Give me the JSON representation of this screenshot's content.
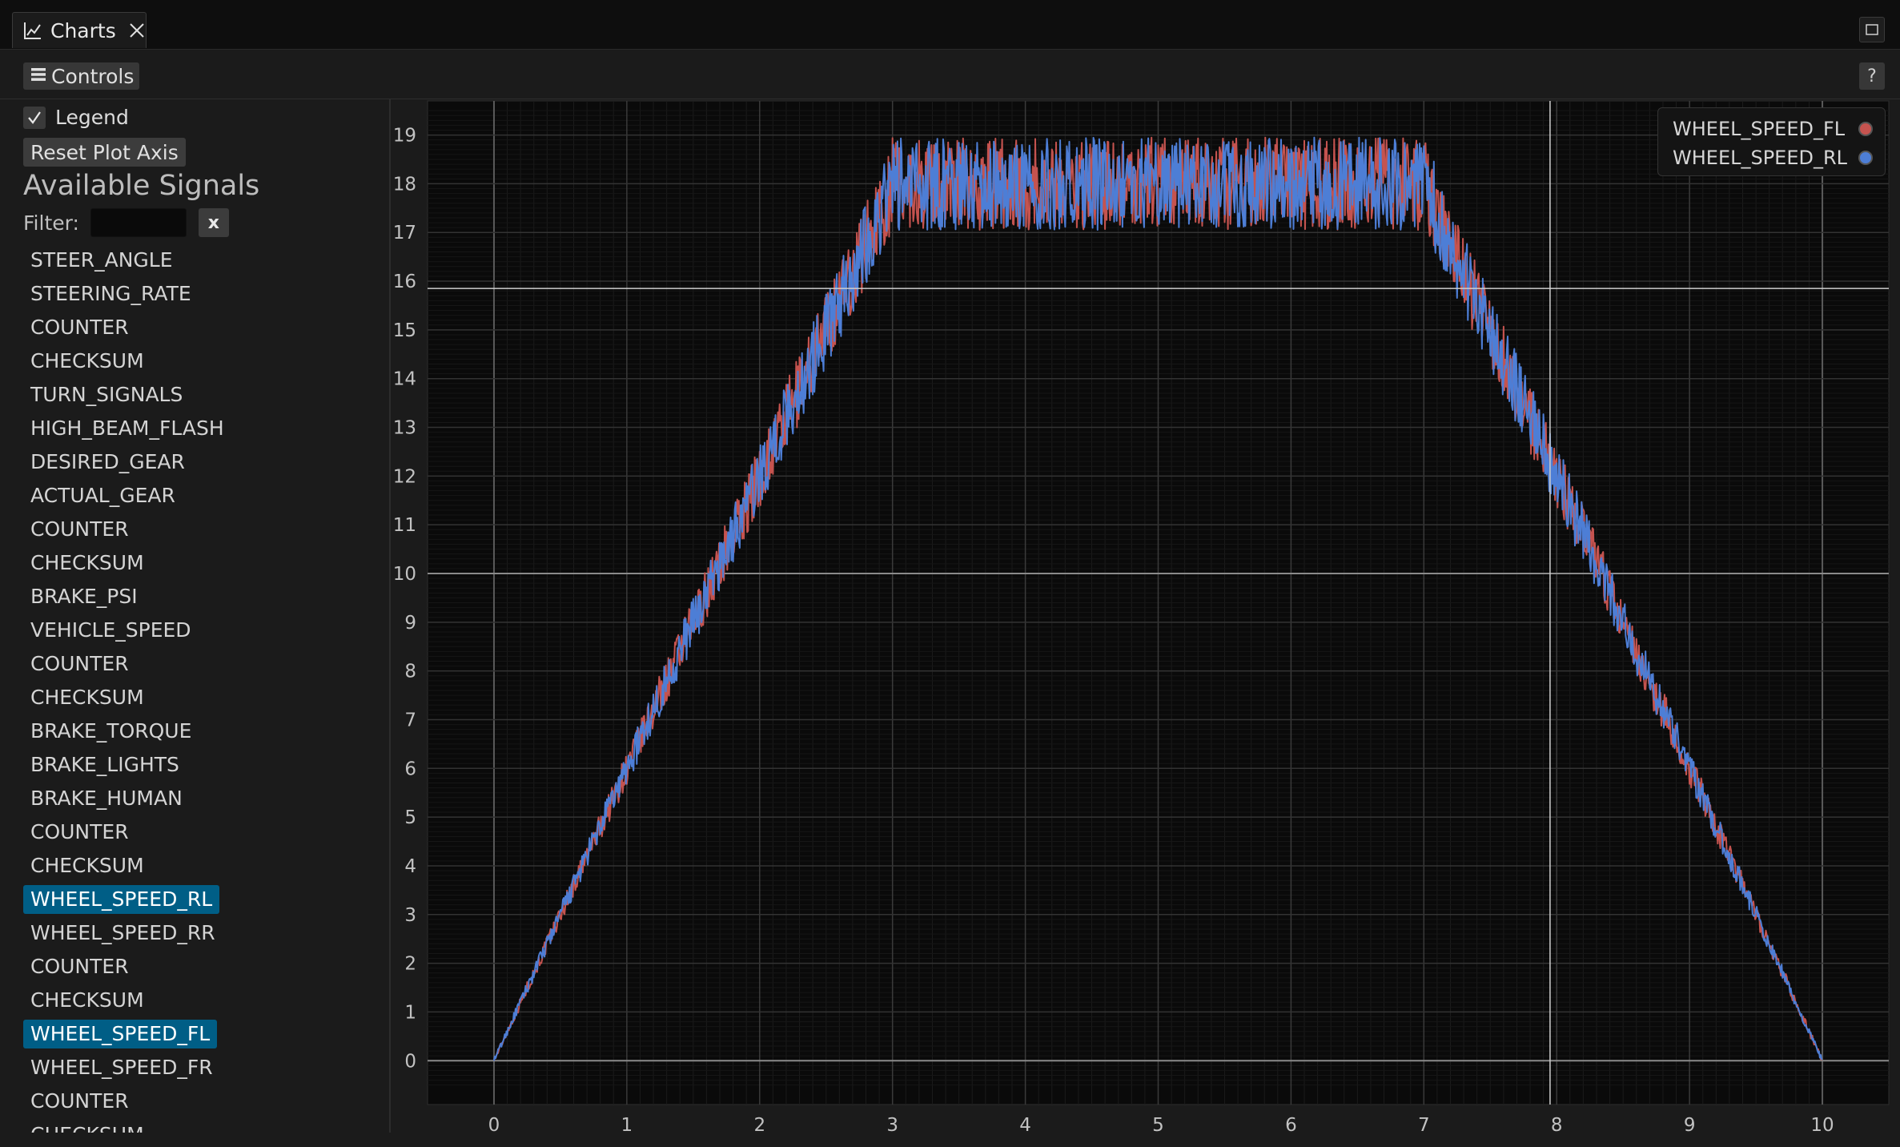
{
  "tab": {
    "title": "Charts",
    "icon": "line-chart-icon"
  },
  "toolbar": {
    "controls_label": "Controls",
    "help_label": "?"
  },
  "panel": {
    "legend_label": "Legend",
    "legend_checked": true,
    "reset_label": "Reset Plot Axis",
    "signals_heading": "Available Signals",
    "filter_label": "Filter:",
    "filter_value": "",
    "clear_label": "x",
    "signals": [
      {
        "label": "STEER_ANGLE",
        "selected": false
      },
      {
        "label": "STEERING_RATE",
        "selected": false
      },
      {
        "label": "COUNTER",
        "selected": false
      },
      {
        "label": "CHECKSUM",
        "selected": false
      },
      {
        "label": "TURN_SIGNALS",
        "selected": false
      },
      {
        "label": "HIGH_BEAM_FLASH",
        "selected": false
      },
      {
        "label": "DESIRED_GEAR",
        "selected": false
      },
      {
        "label": "ACTUAL_GEAR",
        "selected": false
      },
      {
        "label": "COUNTER",
        "selected": false
      },
      {
        "label": "CHECKSUM",
        "selected": false
      },
      {
        "label": "BRAKE_PSI",
        "selected": false
      },
      {
        "label": "VEHICLE_SPEED",
        "selected": false
      },
      {
        "label": "COUNTER",
        "selected": false
      },
      {
        "label": "CHECKSUM",
        "selected": false
      },
      {
        "label": "BRAKE_TORQUE",
        "selected": false
      },
      {
        "label": "BRAKE_LIGHTS",
        "selected": false
      },
      {
        "label": "BRAKE_HUMAN",
        "selected": false
      },
      {
        "label": "COUNTER",
        "selected": false
      },
      {
        "label": "CHECKSUM",
        "selected": false
      },
      {
        "label": "WHEEL_SPEED_RL",
        "selected": true
      },
      {
        "label": "WHEEL_SPEED_RR",
        "selected": false
      },
      {
        "label": "COUNTER",
        "selected": false
      },
      {
        "label": "CHECKSUM",
        "selected": false
      },
      {
        "label": "WHEEL_SPEED_FL",
        "selected": true
      },
      {
        "label": "WHEEL_SPEED_FR",
        "selected": false
      },
      {
        "label": "COUNTER",
        "selected": false
      },
      {
        "label": "CHECKSUM",
        "selected": false
      }
    ]
  },
  "colors": {
    "selected_bg": "#005e86",
    "series_fl": "#c5534f",
    "series_rl": "#4d7ed6"
  },
  "chart_data": {
    "type": "line",
    "x_ticks": [
      "0",
      "1",
      "2",
      "3",
      "4",
      "5",
      "6",
      "7",
      "8",
      "9",
      "10"
    ],
    "y_ticks": [
      "0",
      "1",
      "2",
      "3",
      "4",
      "5",
      "6",
      "7",
      "8",
      "9",
      "10",
      "11",
      "12",
      "13",
      "14",
      "15",
      "16",
      "17",
      "18",
      "19"
    ],
    "xlim": [
      -0.5,
      10.5
    ],
    "ylim": [
      -0.9,
      19.7
    ],
    "grid": true,
    "legend_position": "top-right",
    "crosshair": {
      "x": 7.95,
      "y": 15.85
    },
    "series": [
      {
        "name": "WHEEL_SPEED_FL",
        "color": "#c5534f",
        "noise": 0.9,
        "x": [
          0,
          0.5,
          1,
          1.5,
          2,
          2.5,
          3,
          3.5,
          4,
          4.5,
          5,
          5.5,
          6,
          6.5,
          7,
          7.5,
          8,
          8.5,
          9,
          9.5,
          10
        ],
        "y": [
          0,
          3.0,
          6.0,
          9.0,
          12.0,
          15.0,
          18.0,
          18.0,
          18.0,
          18.0,
          18.0,
          18.0,
          18.0,
          18.0,
          18.0,
          15.0,
          12.0,
          9.0,
          6.0,
          3.0,
          0
        ]
      },
      {
        "name": "WHEEL_SPEED_RL",
        "color": "#4d7ed6",
        "noise": 0.9,
        "x": [
          0,
          0.5,
          1,
          1.5,
          2,
          2.5,
          3,
          3.5,
          4,
          4.5,
          5,
          5.5,
          6,
          6.5,
          7,
          7.5,
          8,
          8.5,
          9,
          9.5,
          10
        ],
        "y": [
          0,
          3.0,
          6.0,
          9.0,
          12.0,
          15.0,
          18.0,
          18.0,
          18.0,
          18.0,
          18.0,
          18.0,
          18.0,
          18.0,
          18.0,
          15.0,
          12.0,
          9.0,
          6.0,
          3.0,
          0
        ]
      }
    ]
  }
}
